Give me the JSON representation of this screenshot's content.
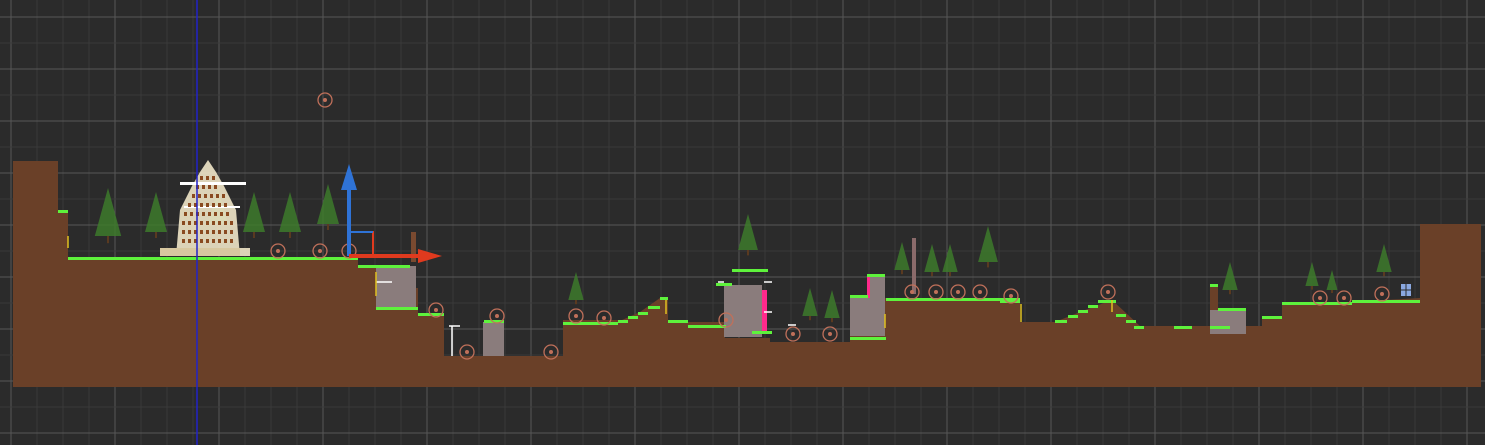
{
  "editor": {
    "view": "scene-2d",
    "grid_visible": true,
    "selection_tool": "move"
  },
  "colors": {
    "background": "#2b2b2b",
    "grid_major": "#575757",
    "grid_minor": "#3a3a3a",
    "ground": "#6a4028",
    "grass": "#5ef23c",
    "stone": "#8a7c7c",
    "tree": "#3d7a2c",
    "axis_x": "#e03a1e",
    "axis_y": "#2f73d6",
    "origin_line": "#2222c8",
    "marker": "#c0705a",
    "highlight": "#ff2a8c"
  },
  "icons": [
    "move-gizmo-icon",
    "point-marker-icon",
    "tree-sprite-icon",
    "window-sprite-icon"
  ]
}
